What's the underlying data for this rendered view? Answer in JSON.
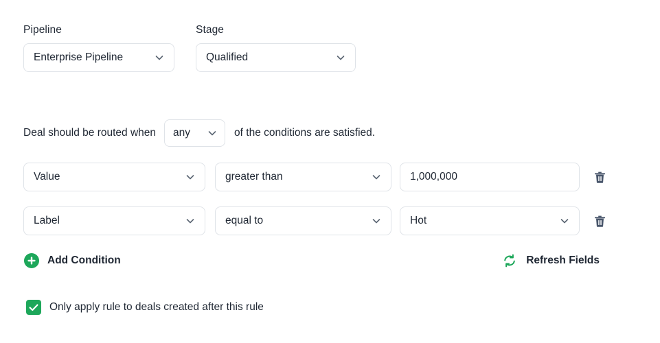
{
  "theme": {
    "accent_green": "#1da75a",
    "text_dark": "#1f2733",
    "border": "#dfe3e8",
    "chevron": "#5b6673",
    "trash": "#49566b",
    "background": "#ffffff"
  },
  "pipeline": {
    "label": "Pipeline",
    "value": "Enterprise Pipeline",
    "chevron_icon": "chevron-down-icon"
  },
  "stage": {
    "label": "Stage",
    "value": "Qualified",
    "chevron_icon": "chevron-down-icon"
  },
  "rule_sentence": {
    "text_before": "Deal should be routed when",
    "match_type": "any",
    "text_after": "of the conditions are satisfied."
  },
  "conditions": [
    {
      "field": "Value",
      "operator": "greater than",
      "value": "1,000,000",
      "value_is_dropdown": false,
      "delete_icon": "trash-icon"
    },
    {
      "field": "Label",
      "operator": "equal to",
      "value": "Hot",
      "value_is_dropdown": true,
      "delete_icon": "trash-icon"
    }
  ],
  "actions": {
    "add_condition_label": "Add Condition",
    "add_condition_icon": "plus-circle-icon",
    "refresh_fields_label": "Refresh Fields",
    "refresh_fields_icon": "refresh-icon"
  },
  "checkbox_option": {
    "label": "Only apply rule to deals created after this rule",
    "checked": true,
    "icon": "check-icon"
  }
}
